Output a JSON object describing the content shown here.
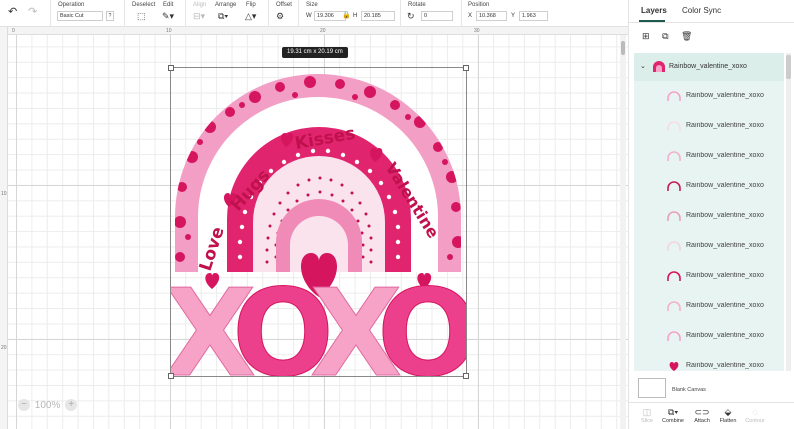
{
  "toolbar": {
    "undo_icon": "undo-icon",
    "redo_icon": "redo-icon",
    "operation_label": "Operation",
    "operation_value": "Basic Cut",
    "operation_help": "?",
    "deselect_label": "Deselect",
    "edit_label": "Edit",
    "align_label": "Align",
    "arrange_label": "Arrange",
    "flip_label": "Flip",
    "offset_label": "Offset",
    "size_label": "Size",
    "size_w_label": "W",
    "size_w_value": "19.306",
    "size_h_label": "H",
    "size_h_value": "20.185",
    "rotate_label": "Rotate",
    "rotate_value": "0",
    "position_label": "Position",
    "pos_x_label": "X",
    "pos_x_value": "10.368",
    "pos_y_label": "Y",
    "pos_y_value": "1.963"
  },
  "canvas": {
    "ruler_top": [
      "0",
      "10",
      "20",
      "30"
    ],
    "ruler_left": [
      "10",
      "20"
    ],
    "size_tag": "19.31  cm x 20.19  cm",
    "zoom_level": "100%",
    "zoom_out": "−",
    "zoom_in": "+"
  },
  "artwork": {
    "words_arc": [
      "Love",
      "Hugs",
      "Kisses",
      "Valentine"
    ],
    "bottom_text": [
      "X",
      "O",
      "X",
      "O"
    ],
    "colors": {
      "light_pink": "#f7a3c8",
      "pink": "#ec3f8c",
      "magenta": "#d6155f",
      "crimson": "#c0104e",
      "outer_pink": "#f39ec5"
    }
  },
  "panel": {
    "tabs": [
      "Layers",
      "Color Sync"
    ],
    "group_name": "Rainbow_valentine_xoxo",
    "layers": [
      {
        "name": "Rainbow_valentine_xoxo",
        "color": "#f7a3c8"
      },
      {
        "name": "Rainbow_valentine_xoxo",
        "color": "#f9dbe8"
      },
      {
        "name": "Rainbow_valentine_xoxo",
        "color": "#f3b1cc"
      },
      {
        "name": "Rainbow_valentine_xoxo",
        "color": "#c41e55"
      },
      {
        "name": "Rainbow_valentine_xoxo",
        "color": "#e8a0bd"
      },
      {
        "name": "Rainbow_valentine_xoxo",
        "color": "#f4d3e1"
      },
      {
        "name": "Rainbow_valentine_xoxo",
        "color": "#d6155f"
      },
      {
        "name": "Rainbow_valentine_xoxo",
        "color": "#f3b1cc"
      },
      {
        "name": "Rainbow_valentine_xoxo",
        "color": "#f7a3c8"
      },
      {
        "name": "Rainbow_valentine_xoxo",
        "color": "#d6155f"
      }
    ],
    "blank_canvas": "Blank Canvas",
    "actions": [
      "Slice",
      "Combine",
      "Attach",
      "Flatten",
      "Contour"
    ]
  }
}
